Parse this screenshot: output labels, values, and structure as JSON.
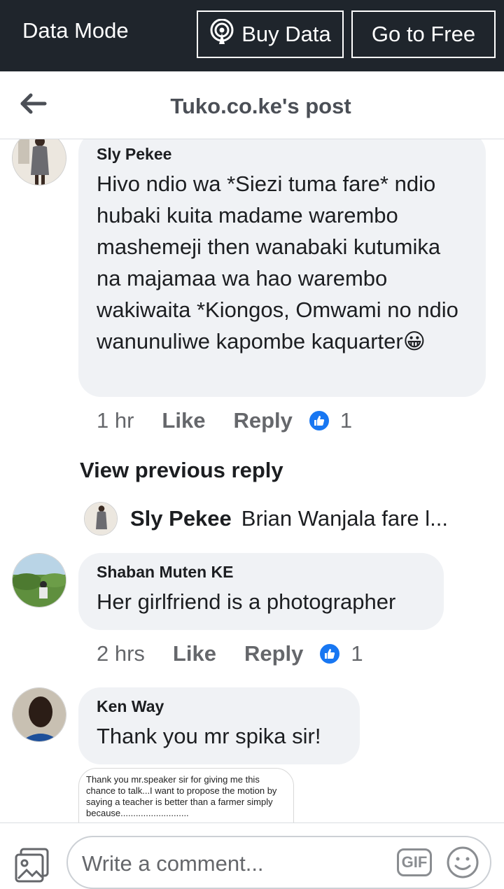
{
  "databar": {
    "mode_label": "Data Mode",
    "buy_label": "Buy Data",
    "free_label": "Go to Free"
  },
  "header": {
    "title": "Tuko.co.ke's post"
  },
  "comments": [
    {
      "name": "Sly Pekee",
      "text": "Hivo ndio wa *Siezi tuma fare* ndio hubaki kuita madame warembo mashemeji then wanabaki kutumika na majamaa wa hao warembo wakiwaita *Kiongos, Omwami no ndio wanunuliwe kapombe kaquarter😀",
      "time": "1 hr",
      "like_label": "Like",
      "reply_label": "Reply",
      "reactions": "1"
    },
    {
      "name": "Shaban Muten KE",
      "text": "Her girlfriend is a photographer",
      "time": "2 hrs",
      "like_label": "Like",
      "reply_label": "Reply",
      "reactions": "1"
    },
    {
      "name": "Ken Way",
      "text": "Thank you mr spika sir!"
    }
  ],
  "view_previous": "View previous reply",
  "reply_preview": {
    "name": "Sly Pekee",
    "text": "Brian Wanjala fare l..."
  },
  "attachment_text": "Thank you mr.speaker sir for giving me this chance to talk...I want to propose the motion by saying a teacher is better than a farmer simply because...........................",
  "composer": {
    "placeholder": "Write a comment...",
    "gif_label": "GIF"
  },
  "colors": {
    "databar_bg": "#1f252c",
    "bubble_bg": "#f0f2f5",
    "like_blue": "#1877f2",
    "meta_gray": "#65676b"
  },
  "icons": [
    "back-arrow-icon",
    "wifi-broadcast-icon",
    "thumbs-up-icon",
    "photo-icon",
    "gif-icon",
    "emoji-icon"
  ]
}
